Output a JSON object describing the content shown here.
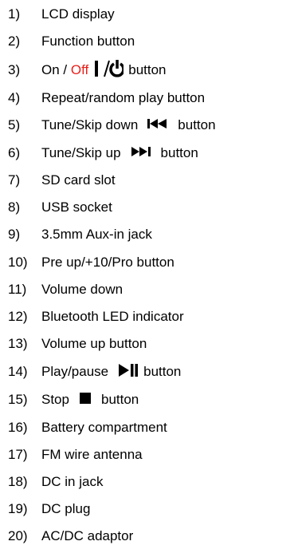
{
  "items": [
    {
      "num": "1)",
      "text": "LCD display"
    },
    {
      "num": "2)",
      "text": "Function button"
    },
    {
      "num": "3)",
      "pre": "On / ",
      "off": "Off",
      "post": "button",
      "icon": "power-toggle-icon"
    },
    {
      "num": "4)",
      "text": "Repeat/random play button"
    },
    {
      "num": "5)",
      "pre": "Tune/Skip down",
      "post": "button",
      "icon": "skip-previous-icon"
    },
    {
      "num": "6)",
      "pre": "Tune/Skip up",
      "post": "button",
      "icon": "skip-next-icon"
    },
    {
      "num": "7)",
      "text": "SD card slot"
    },
    {
      "num": "8)",
      "text": "USB socket"
    },
    {
      "num": "9)",
      "text": "3.5mm Aux-in jack"
    },
    {
      "num": "10)",
      "text": "Pre up/+10/Pro button"
    },
    {
      "num": "11)",
      "text": "Volume down"
    },
    {
      "num": "12)",
      "text": "Bluetooth LED indicator"
    },
    {
      "num": "13)",
      "text": "Volume up button"
    },
    {
      "num": "14)",
      "pre": "Play/pause",
      "post": "button",
      "icon": "play-pause-icon"
    },
    {
      "num": "15)",
      "pre": "Stop",
      "post": "button",
      "icon": "stop-icon"
    },
    {
      "num": "16)",
      "text": "Battery compartment"
    },
    {
      "num": "17)",
      "text": "FM wire antenna"
    },
    {
      "num": "18)",
      "text": "DC in jack"
    },
    {
      "num": "19)",
      "text": "DC plug"
    },
    {
      "num": "20)",
      "text": "AC/DC adaptor"
    }
  ],
  "colors": {
    "text": "#000000",
    "off": "#e8201a"
  }
}
